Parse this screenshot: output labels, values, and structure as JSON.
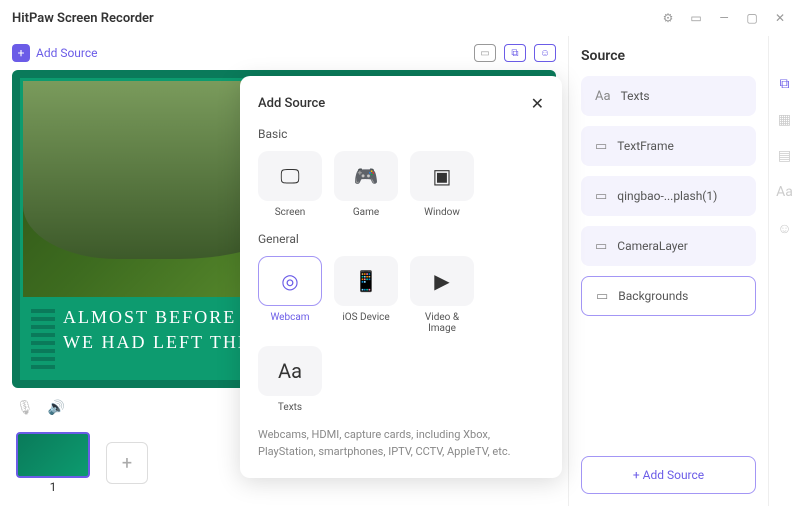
{
  "titlebar": {
    "title": "HitPaw Screen Recorder"
  },
  "toolbar": {
    "addSource": "Add Source"
  },
  "preview": {
    "line1": "ALMOST BEFORE WE",
    "line2": "WE HAD LEFT THE G"
  },
  "thumbs": {
    "label1": "1"
  },
  "sidebar": {
    "title": "Source",
    "items": [
      {
        "label": "Texts",
        "icon": "Aa"
      },
      {
        "label": "TextFrame",
        "icon": "▭"
      },
      {
        "label": "qingbao-...plash(1)",
        "icon": "▭"
      },
      {
        "label": "CameraLayer",
        "icon": "▭"
      },
      {
        "label": "Backgrounds",
        "icon": "▭"
      }
    ],
    "addBtn": "+  Add Source"
  },
  "modal": {
    "title": "Add Source",
    "section1": "Basic",
    "section2": "General",
    "basic": [
      {
        "label": "Screen"
      },
      {
        "label": "Game"
      },
      {
        "label": "Window"
      }
    ],
    "general": [
      {
        "label": "Webcam"
      },
      {
        "label": "iOS Device"
      },
      {
        "label": "Video & Image"
      },
      {
        "label": "Texts"
      }
    ],
    "desc": "Webcams, HDMI, capture cards, including Xbox, PlayStation, smartphones, IPTV, CCTV, AppleTV, etc."
  }
}
